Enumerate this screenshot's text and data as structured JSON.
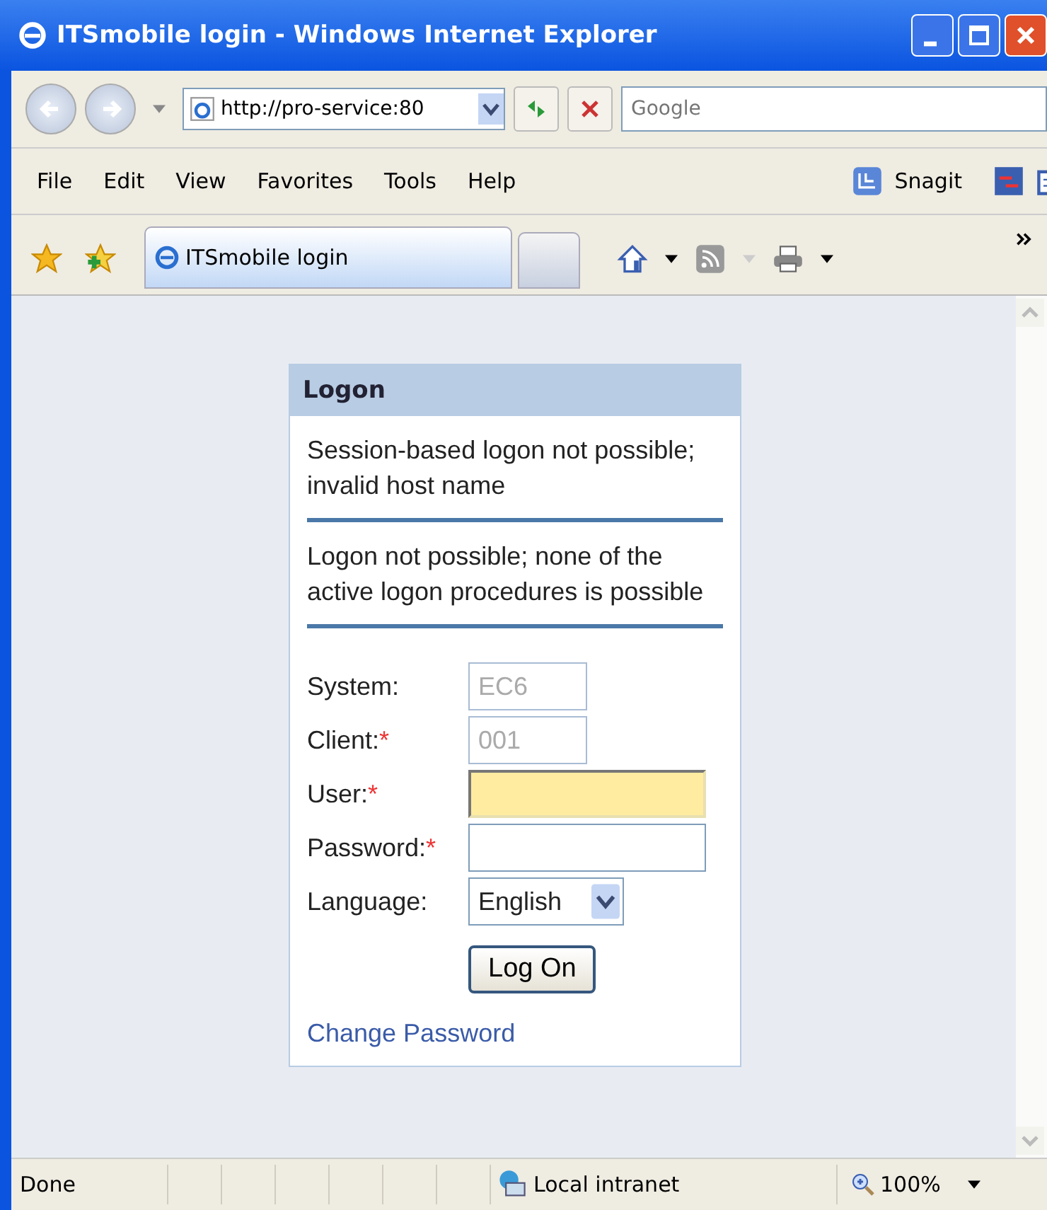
{
  "window": {
    "title": "ITSmobile login - Windows Internet Explorer"
  },
  "address_bar": {
    "value": "http://pro-service:80"
  },
  "search": {
    "placeholder": "Google"
  },
  "menu": [
    "File",
    "Edit",
    "View",
    "Favorites",
    "Tools",
    "Help"
  ],
  "toolbar": {
    "snagit": "Snagit"
  },
  "tabs": [
    {
      "label": "ITSmobile login",
      "selected": true
    }
  ],
  "logon": {
    "title": "Logon",
    "messages": [
      "Session-based logon not possible; invalid host name",
      "Logon not possible; none of the active logon procedures is possible"
    ],
    "fields": [
      {
        "label": "System:",
        "kind": "text",
        "value": "EC6",
        "disabled": true,
        "focused": false
      },
      {
        "label": "Client:",
        "required_mark": "*",
        "kind": "text",
        "value": "001",
        "disabled": true,
        "focused": false
      },
      {
        "label": "User:",
        "required_mark": "*",
        "kind": "text",
        "disabled": false,
        "focused": true
      },
      {
        "label": "Password:",
        "required_mark": "*",
        "kind": "password",
        "disabled": false,
        "focused": false
      },
      {
        "label": "Language:",
        "kind": "select",
        "value": "English"
      }
    ],
    "button": "Log On",
    "link": "Change Password"
  },
  "status_bar": {
    "text": "Done",
    "zone": "Local intranet",
    "zoom": "100%"
  }
}
